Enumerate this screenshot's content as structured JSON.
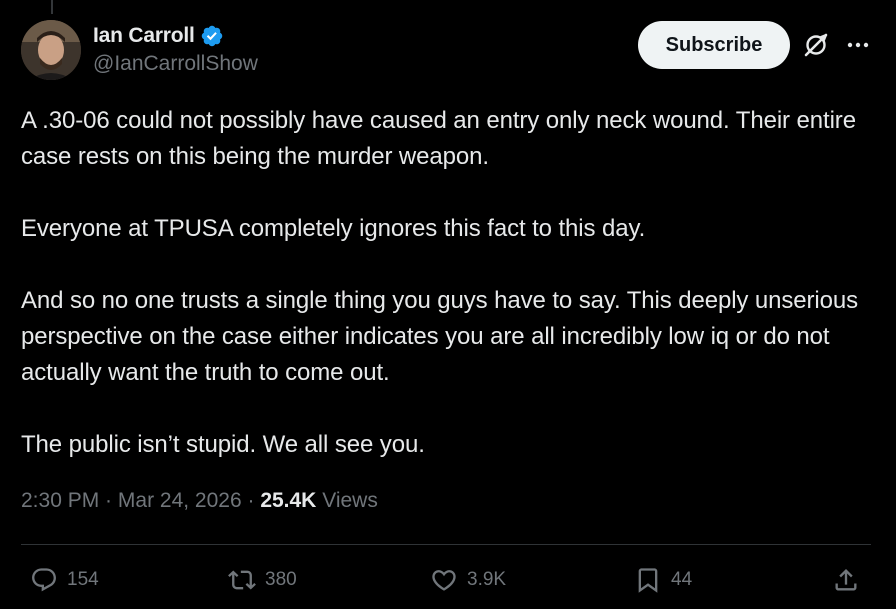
{
  "author": {
    "display_name": "Ian Carroll",
    "handle": "@IanCarrollShow",
    "verified": true
  },
  "header_actions": {
    "subscribe_label": "Subscribe",
    "icons": [
      "grok-icon",
      "more-icon"
    ]
  },
  "tweet": {
    "paragraphs": [
      "A .30-06 could not possibly have caused an entry only neck wound. Their entire case rests on this being the murder weapon.",
      "Everyone at TPUSA completely ignores this fact to this day.",
      "And so no one trusts a single thing you guys have to say. This deeply unserious perspective on the case either indicates you are all incredibly low iq or do not actually want the truth to come out.",
      "The public isn’t stupid. We all see you."
    ]
  },
  "meta": {
    "time": "2:30 PM",
    "separator": " · ",
    "date": "Mar 24, 2026",
    "views_count": "25.4K",
    "views_label": "Views"
  },
  "actions": {
    "replies": "154",
    "reposts": "380",
    "likes": "3.9K",
    "bookmarks": "44"
  },
  "colors": {
    "background": "#000000",
    "text_primary": "#e7e9ea",
    "text_secondary": "#71767b",
    "verified_blue": "#1d9bf0",
    "divider": "#2f3336",
    "subscribe_bg": "#eff3f4"
  }
}
